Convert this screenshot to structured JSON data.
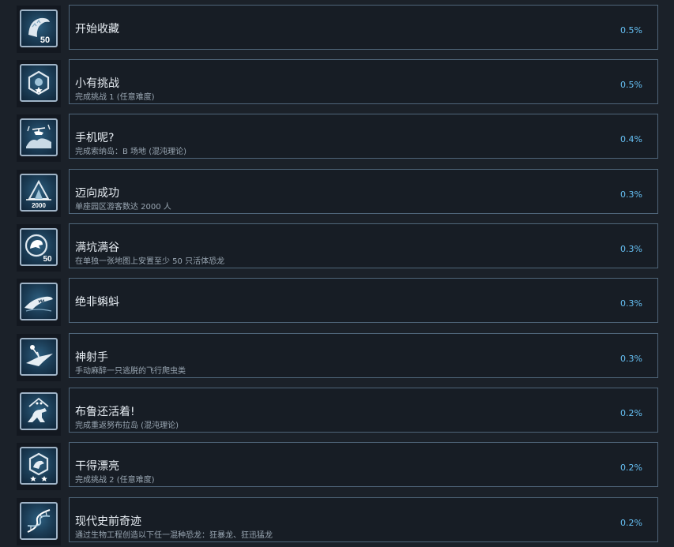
{
  "achievements": [
    {
      "title": "开始收藏",
      "desc": "",
      "pct": "0.5%",
      "icon": "raptor-claw-50-icon"
    },
    {
      "title": "小有挑战",
      "desc": "完成挑战 1 (任意难度)",
      "pct": "0.5%",
      "icon": "hexagon-badge-star-icon"
    },
    {
      "title": "手机呢?",
      "desc": "完成索纳岛：B 场地 (混沌理论)",
      "pct": "0.4%",
      "icon": "helicopter-island-icon"
    },
    {
      "title": "迈向成功",
      "desc": "单座园区游客数达 2000 人",
      "pct": "0.3%",
      "icon": "gate-2000-icon"
    },
    {
      "title": "满坑满谷",
      "desc": "在单独一张地图上安置至少 50 只活体恐龙",
      "pct": "0.3%",
      "icon": "trex-logo-50-icon"
    },
    {
      "title": "绝非蝌蚪",
      "desc": "",
      "pct": "0.3%",
      "icon": "mosasaurus-icon"
    },
    {
      "title": "神射手",
      "desc": "手动麻醉一只逃脱的飞行爬虫类",
      "pct": "0.3%",
      "icon": "pteranodon-dart-icon"
    },
    {
      "title": "布鲁还活着!",
      "desc": "完成重返努布拉岛 (混沌理论)",
      "pct": "0.2%",
      "icon": "raptor-triangle-icon"
    },
    {
      "title": "干得漂亮",
      "desc": "完成挑战 2 (任意难度)",
      "pct": "0.2%",
      "icon": "hexagon-badge-two-stars-icon"
    },
    {
      "title": "现代史前奇迹",
      "desc": "通过生物工程创造以下任一混种恐龙：狂暴龙、狂迅猛龙",
      "pct": "0.2%",
      "icon": "dna-helix-icon"
    }
  ],
  "colors": {
    "background": "#1b2129",
    "panel_border": "#4f6579",
    "percent": "#66c0f4",
    "title": "#e8eef4",
    "desc": "#9aa7b3"
  }
}
